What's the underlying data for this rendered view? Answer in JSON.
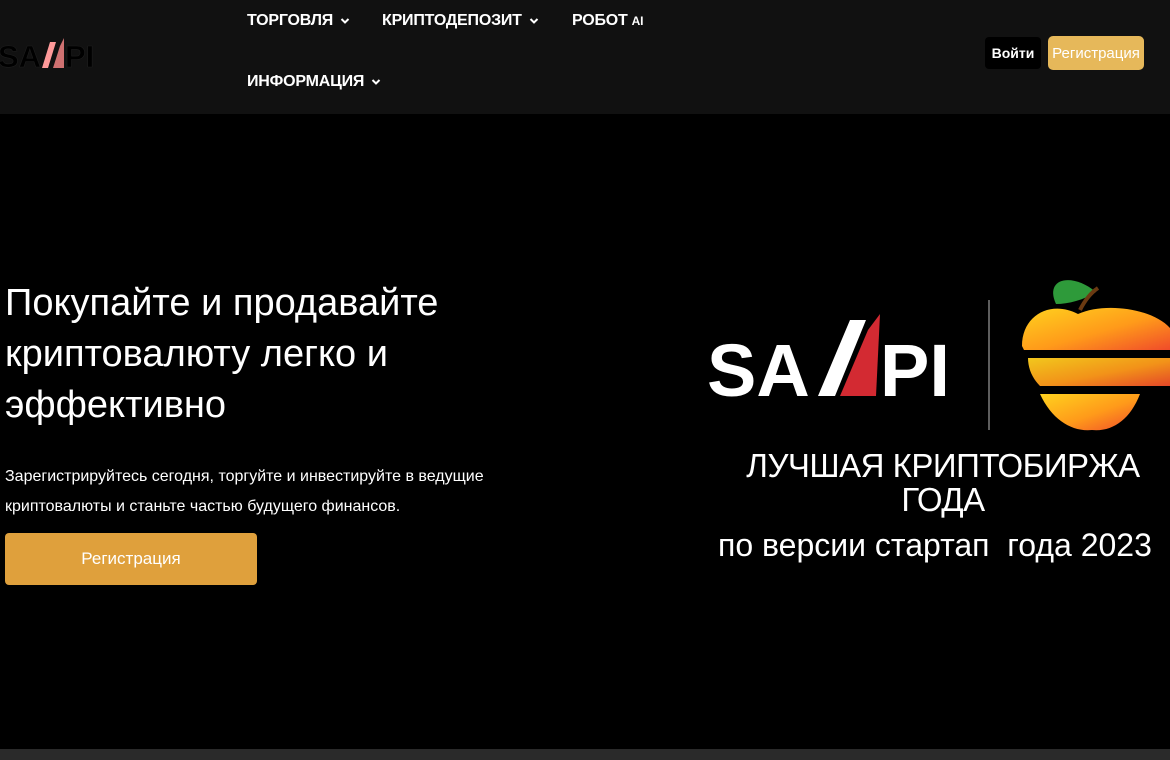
{
  "brand": {
    "name": "SAMPI",
    "accent_color": "#cc1f2a"
  },
  "nav": {
    "items": [
      {
        "label": "ТОРГОВЛЯ",
        "has_dropdown": true
      },
      {
        "label": "КРИПТОДЕПОЗИТ",
        "has_dropdown": true
      },
      {
        "label": "РОБОТ",
        "suffix": "AI",
        "has_dropdown": false
      },
      {
        "label": "ИНФОРМАЦИЯ",
        "has_dropdown": true
      }
    ],
    "login_label": "Войти",
    "register_label": "Регистрация"
  },
  "hero": {
    "title": "Покупайте и продавайте криптовалюту легко и эффективно",
    "subtitle": "Зарегистрируйтесь сегодня, торгуйте и инвестируйте в ведущие криптовалюты и станьте частью будущего финансов.",
    "cta_label": "Регистрация",
    "cta_color": "#dfa03c"
  },
  "badge": {
    "logo_text": "SAMPI",
    "award_title": "ЛУЧШАЯ КРИПТОБИРЖА ГОДА",
    "award_subtitle": "по версии стартап  года 2023",
    "icon": "apple-icon"
  },
  "colors": {
    "background": "#000000",
    "header": "#111111",
    "button_top": "#e6b85a"
  }
}
